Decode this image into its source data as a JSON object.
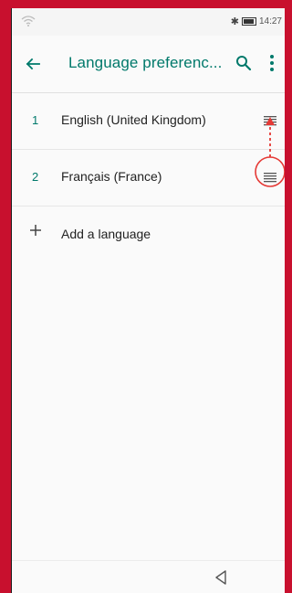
{
  "status_bar": {
    "time": "14:27",
    "icons": [
      "wifi-icon",
      "bluetooth-icon",
      "battery-icon"
    ]
  },
  "app_bar": {
    "title": "Language preferenc...",
    "back_icon": "arrow-left-icon",
    "search_icon": "search-icon",
    "more_icon": "more-vert-icon"
  },
  "languages": [
    {
      "index": "1",
      "label": "English (United Kingdom)"
    },
    {
      "index": "2",
      "label": "Français (France)"
    }
  ],
  "add_language": {
    "label": "Add a language",
    "icon": "plus-icon"
  },
  "nav_bar": {
    "back_icon": "triangle-back-icon"
  },
  "colors": {
    "accent": "#00796b",
    "annotation": "#e53935",
    "frame": "#c8102e"
  }
}
